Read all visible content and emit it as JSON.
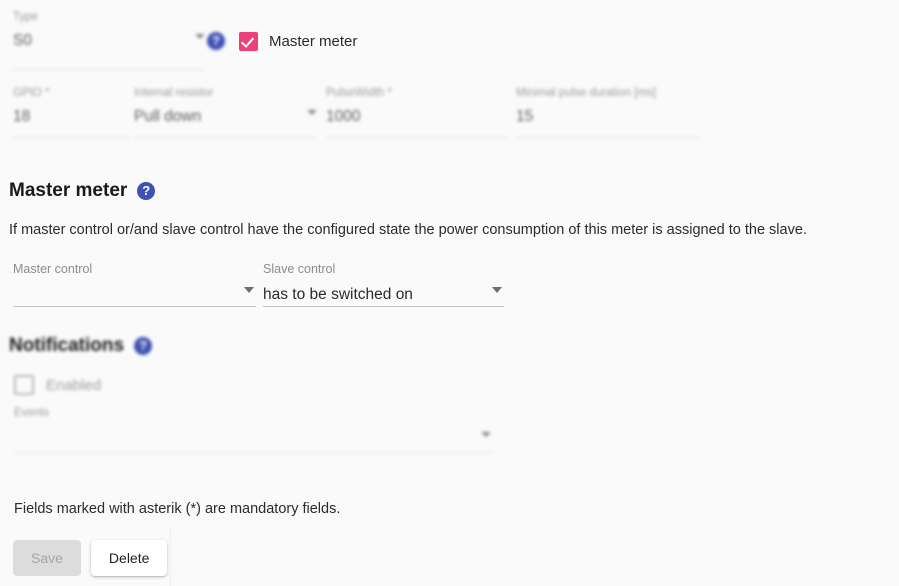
{
  "theme": {
    "background": "#fafafa",
    "checkbox_accent": "#ec407a",
    "help_icon_color": "#3f51b5",
    "text_color": "#222222",
    "muted_label_color": "#9a9a9a",
    "underline_color": "#c6c6c6"
  },
  "top_form": {
    "type_field": {
      "label": "Type",
      "value": "S0",
      "caret_icon": "chevron-down-icon"
    },
    "help_icon": "help-circle-icon",
    "master_meter_checkbox": {
      "label": "Master meter",
      "checked": true
    },
    "gpio_field": {
      "label": "GPIO *",
      "value": "18"
    },
    "internal_resistor_field": {
      "label": "Internal resistor",
      "value": "Pull down",
      "caret_icon": "chevron-down-icon"
    },
    "pulsewidth_field": {
      "label": "PulseWidth *",
      "value": "1000"
    },
    "minimal_pulse_duration_field": {
      "label": "Minimal pulse duration [ms]",
      "value": "15"
    }
  },
  "master_meter_section": {
    "heading": "Master meter",
    "help_icon": "help-circle-icon",
    "description": "If master control or/and slave control have the configured state the power consumption of this meter is assigned to the slave.",
    "master_control": {
      "label": "Master control",
      "value": "",
      "caret_icon": "chevron-down-icon"
    },
    "slave_control": {
      "label": "Slave control",
      "value": "has to be switched on",
      "caret_icon": "chevron-down-icon"
    }
  },
  "notifications_section": {
    "heading": "Notifications",
    "help_icon": "help-circle-icon",
    "enabled_checkbox": {
      "label": "Enabled",
      "checked": false
    },
    "events_field": {
      "label": "Events",
      "value": "",
      "caret_icon": "chevron-down-icon"
    }
  },
  "footer": {
    "mandatory_note": "Fields marked with asterik (*) are mandatory fields.",
    "save_label": "Save",
    "delete_label": "Delete"
  }
}
